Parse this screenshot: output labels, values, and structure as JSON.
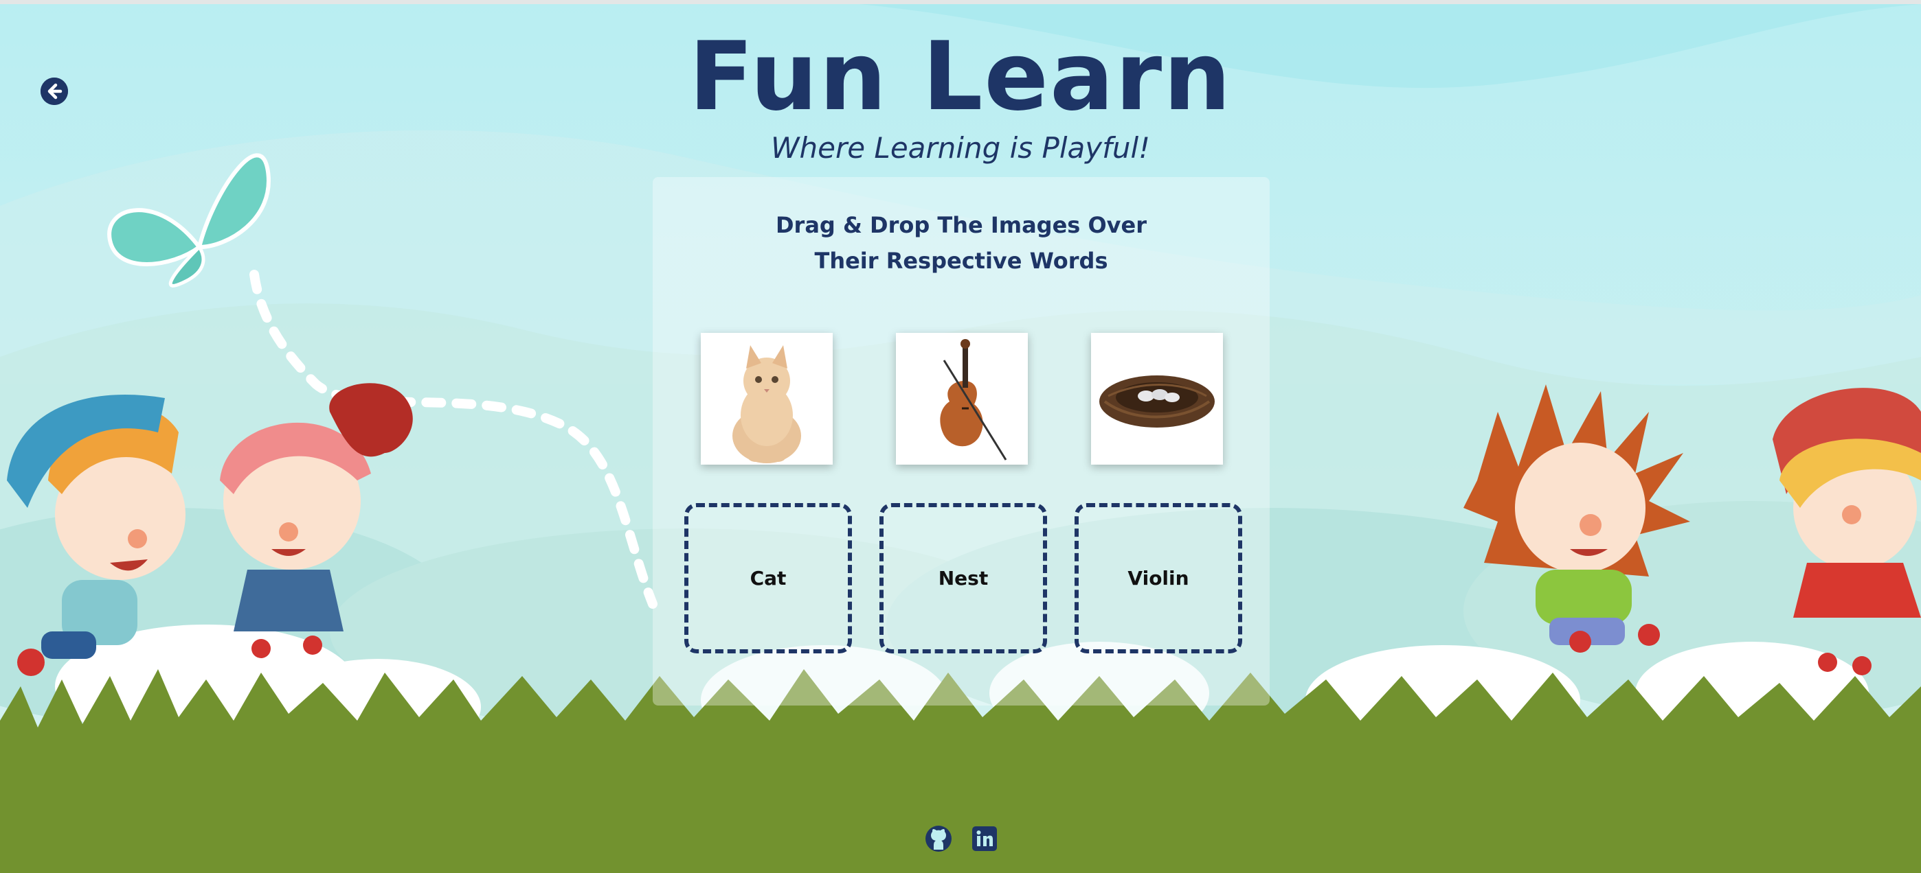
{
  "app": {
    "title": "Fun Learn",
    "tagline": "Where Learning is Playful!"
  },
  "nav": {
    "back_icon": "arrow-left-circle-icon"
  },
  "game": {
    "instructions": [
      "Drag & Drop The Images Over",
      "Their Respective Words"
    ],
    "images": [
      {
        "name": "cat",
        "icon": "cat-image"
      },
      {
        "name": "violin",
        "icon": "violin-image"
      },
      {
        "name": "nest",
        "icon": "nest-image"
      }
    ],
    "drop_targets": [
      "Cat",
      "Nest",
      "Violin"
    ]
  },
  "footer": {
    "links": [
      {
        "icon": "github-icon"
      },
      {
        "icon": "linkedin-icon"
      }
    ]
  },
  "colors": {
    "primary": "#1e3566",
    "sky": "#bfeef0",
    "grass": "#72922f"
  }
}
